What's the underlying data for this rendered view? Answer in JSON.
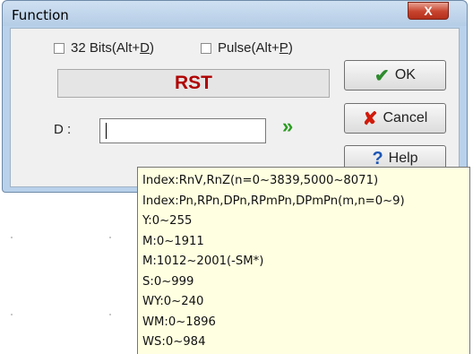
{
  "dialog": {
    "title": "Function",
    "close_label": "X"
  },
  "options": {
    "bits_prefix": "32 Bits(Alt+",
    "bits_key": "D",
    "bits_suffix": ")",
    "bits_checked": false,
    "pulse_prefix": "Pulse(Alt+",
    "pulse_key": "P",
    "pulse_suffix": ")",
    "pulse_checked": false
  },
  "instruction": {
    "name": "RST",
    "name_color": "#b00000"
  },
  "operand": {
    "label": "D :",
    "value": "",
    "arrow_icon": "double-chevron-right-icon",
    "arrow_glyph": "»"
  },
  "buttons": {
    "ok_label": "OK",
    "ok_icon": "checkmark-icon",
    "ok_glyph": "✔",
    "cancel_label": "Cancel",
    "cancel_icon": "x-icon",
    "cancel_glyph": "✘",
    "help_label": "Help",
    "help_icon": "question-mark-icon",
    "help_glyph": "?"
  },
  "tooltip": {
    "lines": [
      "Index:RnV,RnZ(n=0~3839,5000~8071)",
      "Index:Pn,RPn,DPn,RPmPn,DPmPn(m,n=0~9)",
      "Y:0~255",
      "M:0~1911",
      "M:1012~2001(-SM*)",
      "S:0~999",
      "WY:0~240",
      "WM:0~1896",
      "WS:0~984"
    ]
  }
}
